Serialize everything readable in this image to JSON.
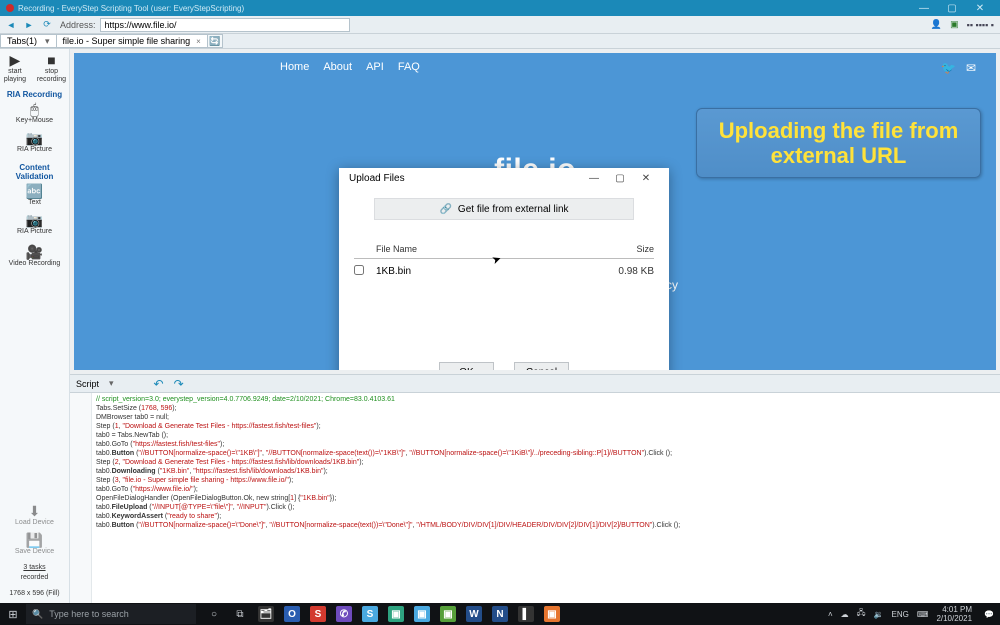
{
  "window": {
    "title": "Recording - EveryStep Scripting Tool (user: EveryStepScripting)",
    "min": "—",
    "max": "▢",
    "close": "✕"
  },
  "address": {
    "label": "Address:",
    "url": "https://www.file.io/"
  },
  "tabs": {
    "selector": "Tabs(1)",
    "active_tab": "file.io - Super simple file sharing",
    "close_x": "×",
    "add": "+"
  },
  "sidebar": {
    "top": [
      {
        "icon": "▶",
        "label": "start\nplaying"
      },
      {
        "icon": "■",
        "label": "stop\nrecording"
      }
    ],
    "ria_title": "RIA Recording",
    "ria_items": [
      {
        "icon": "🖱",
        "label": "Key+Mouse"
      },
      {
        "icon": "📷",
        "label": "RIA Picture"
      }
    ],
    "cv_title": "Content Validation",
    "cv_items": [
      {
        "icon": "🔤",
        "label": "Text"
      },
      {
        "icon": "📷",
        "label": "RIA Picture"
      }
    ],
    "vr_item": {
      "icon": "🎥",
      "label": "Video Recording"
    },
    "bottom_items": [
      {
        "icon": "⬇",
        "label": "Load Device"
      },
      {
        "icon": "💾",
        "label": "Save Device"
      }
    ],
    "status1": "3 tasks recorded",
    "status1_link": "3 tasks",
    "status1_rest": "recorded",
    "status2": "1768 x 596 (Fill)"
  },
  "site": {
    "nav": [
      "Home",
      "About",
      "API",
      "FAQ"
    ],
    "title": "file.io",
    "policy": "olicy",
    "twitter": "🐦",
    "mail": "✉"
  },
  "callout": "Uploading the file from external URL",
  "dialog": {
    "title": "Upload Files",
    "min": "—",
    "max": "▢",
    "close": "✕",
    "getfile": "Get file from external link",
    "link_icon": "🔗",
    "head_name": "File Name",
    "head_size": "Size",
    "row_name": "1KB.bin",
    "row_size": "0.98 KB",
    "ok": "OK",
    "cancel": "Cancel"
  },
  "script": {
    "label": "Script",
    "lines": {
      "l1": "// script_version=3.0; everystep_version=4.0.7706.9249; date=2/10/2021; Chrome=83.0.4103.61",
      "l2a": "Tabs.SetSize (",
      "l2b": "1768",
      "l2c": ", ",
      "l2d": "596",
      "l2e": ");",
      "l3": "DMBrowser tab0 = null;",
      "l4a": "Step (",
      "l4b": "1",
      "l4c": ", ",
      "l4d": "\"Download & Generate Test Files - https://fastest.fish/test-files\"",
      "l4e": ");",
      "l5": "tab0 = Tabs.NewTab ();",
      "l6a": "tab0.GoTo (",
      "l6b": "\"https://fastest.fish/test-files\"",
      "l6c": ");",
      "l7a": "tab0.",
      "l7b": "Button",
      "l7c": " (",
      "l7d": "\"//BUTTON[normalize-space()=\\\"1KB\\\"]\"",
      "l7e": ", ",
      "l7f": "\"//BUTTON[normalize-space(text())=\\\"1KB\\\"]\"",
      "l7g": ", ",
      "l7h": "\"//BUTTON[normalize-space()=\\\"1KiB\\\"]/../preceding-sibling::P[1]//BUTTON\"",
      "l7i": ").Click ();",
      "l8a": "Step (",
      "l8b": "2",
      "l8c": ", ",
      "l8d": "\"Download & Generate Test Files - https://fastest.fish/lib/downloads/1KB.bin\"",
      "l8e": ");",
      "l9a": "tab0.",
      "l9b": "Downloading",
      "l9c": " (",
      "l9d": "\"1KB.bin\"",
      "l9e": ", ",
      "l9f": "\"https://fastest.fish/lib/downloads/1KB.bin\"",
      "l9g": ");",
      "l10a": "Step (",
      "l10b": "3",
      "l10c": ", ",
      "l10d": "\"file.io - Super simple file sharing - https://www.file.io/\"",
      "l10e": ");",
      "l11a": "tab0.GoTo (",
      "l11b": "\"https://www.file.io/\"",
      "l11c": ");",
      "l12a": "OpenFileDialogHandler (OpenFileDialogButton.Ok, new string[",
      "l12b": "1",
      "l12c": "] {",
      "l12d": "\"1KB.bin\"",
      "l12e": "});",
      "l13a": "tab0.",
      "l13b": "FileUpload",
      "l13c": " (",
      "l13d": "\"//INPUT[@TYPE=\\\"file\\\"]\"",
      "l13e": ", ",
      "l13f": "\"//INPUT\"",
      "l13g": ").Click ();",
      "l14a": "tab0.",
      "l14b": "KeywordAssert",
      "l14c": " (",
      "l14d": "\"ready to share\"",
      "l14e": ");",
      "l15a": "tab0.",
      "l15b": "Button",
      "l15c": " (",
      "l15d": "\"//BUTTON[normalize-space()=\\\"Done\\\"]\"",
      "l15e": ", ",
      "l15f": "\"//BUTTON[normalize-space(text())=\\\"Done\\\"]\"",
      "l15g": ", ",
      "l15h": "\"/HTML/BODY/DIV/DIV[1]/DIV/HEADER/DIV/DIV[2]/DIV[1]/DIV[2]/BUTTON\"",
      "l15i": ").Click ();"
    }
  },
  "taskbar": {
    "search_placeholder": "Type here to search",
    "tray_lang": "ENG",
    "time": "4:01 PM",
    "date": "2/10/2021"
  }
}
